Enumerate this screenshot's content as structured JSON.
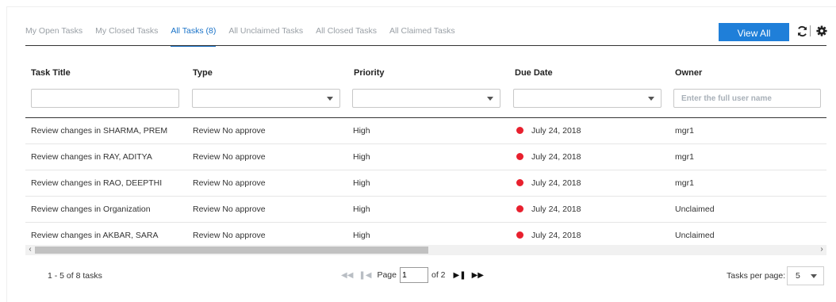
{
  "tabs": [
    {
      "label": "My Open Tasks",
      "active": false
    },
    {
      "label": "My Closed Tasks",
      "active": false
    },
    {
      "label": "All Tasks (8)",
      "active": true
    },
    {
      "label": "All Unclaimed Tasks",
      "active": false
    },
    {
      "label": "All Closed Tasks",
      "active": false
    },
    {
      "label": "All Claimed Tasks",
      "active": false
    }
  ],
  "toolbar": {
    "view_all_label": "View All",
    "refresh_icon": "refresh-icon",
    "settings_icon": "gear-icon"
  },
  "table": {
    "columns": [
      "Task Title",
      "Type",
      "Priority",
      "Due Date",
      "Owner"
    ],
    "filters": {
      "title_value": "",
      "type_value": "",
      "priority_value": "",
      "due_value": "",
      "owner_placeholder": "Enter the full user name"
    },
    "rows": [
      {
        "title": "Review changes in SHARMA, PREM",
        "type": "Review No approve",
        "priority": "High",
        "due": "July 24, 2018",
        "owner": "mgr1"
      },
      {
        "title": "Review changes in RAY, ADITYA",
        "type": "Review No approve",
        "priority": "High",
        "due": "July 24, 2018",
        "owner": "mgr1"
      },
      {
        "title": "Review changes in RAO, DEEPTHI",
        "type": "Review No approve",
        "priority": "High",
        "due": "July 24, 2018",
        "owner": "mgr1"
      },
      {
        "title": "Review changes in Organization",
        "type": "Review No approve",
        "priority": "High",
        "due": "July 24, 2018",
        "owner": "Unclaimed"
      },
      {
        "title": "Review changes in AKBAR, SARA",
        "type": "Review No approve",
        "priority": "High",
        "due": "July 24, 2018",
        "owner": "Unclaimed"
      }
    ],
    "due_status_color": "#e8202e"
  },
  "footer": {
    "count_text": "1 - 5 of 8 tasks",
    "page_label": "Page",
    "page_value": "1",
    "page_of": "of 2",
    "per_page_label": "Tasks per page:",
    "per_page_value": "5"
  },
  "colors": {
    "accent": "#1f7fd9",
    "active_tab": "#1a73c8"
  }
}
